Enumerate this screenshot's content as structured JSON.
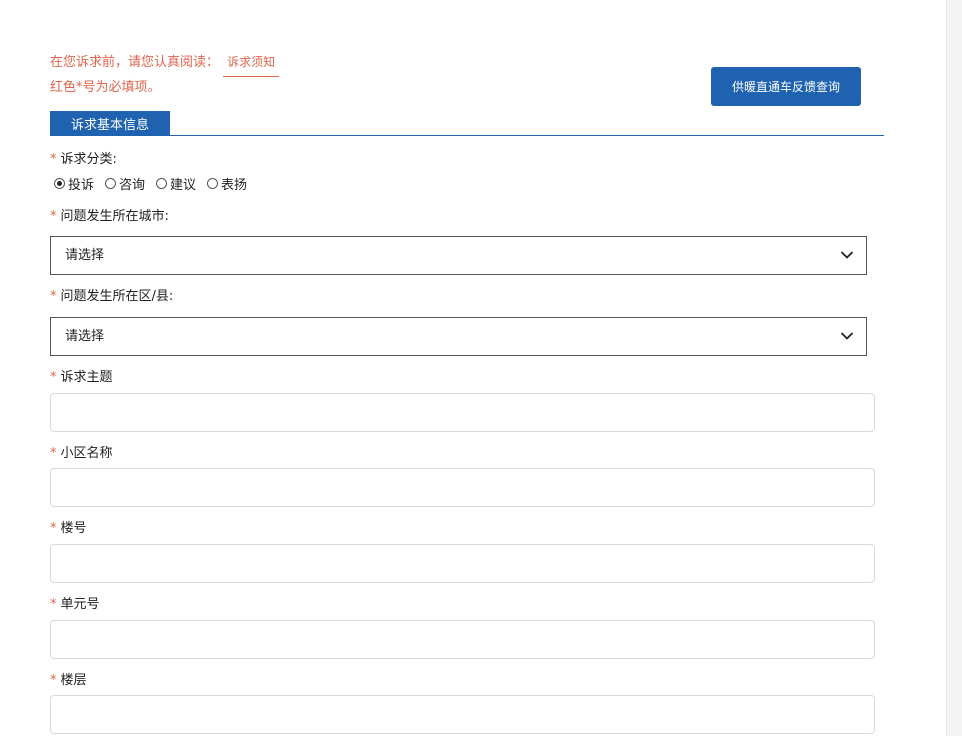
{
  "notice": {
    "intro": "在您诉求前，请您认真阅读：",
    "link": "诉求须知",
    "required_hint": "红色*号为必填项。"
  },
  "feedback_button": "供暖直通车反馈查询",
  "section_title": "诉求基本信息",
  "required_mark": "*",
  "fields": {
    "category": {
      "label": "诉求分类:",
      "options": [
        "投诉",
        "咨询",
        "建议",
        "表扬"
      ],
      "selected": "投诉"
    },
    "city": {
      "label": "问题发生所在城市:",
      "value": "请选择"
    },
    "district": {
      "label": "问题发生所在区/县:",
      "value": "请选择"
    },
    "subject": {
      "label": "诉求主题",
      "value": ""
    },
    "community": {
      "label": "小区名称",
      "value": ""
    },
    "building": {
      "label": "楼号",
      "value": ""
    },
    "unit": {
      "label": "单元号",
      "value": ""
    },
    "floor": {
      "label": "楼层",
      "value": ""
    }
  },
  "icons": {
    "dropdown": "chevron-down-icon",
    "radio": "radio-icon"
  },
  "colors": {
    "primary": "#1f63b0",
    "required": "#e0644e",
    "notice": "#e0644e"
  }
}
